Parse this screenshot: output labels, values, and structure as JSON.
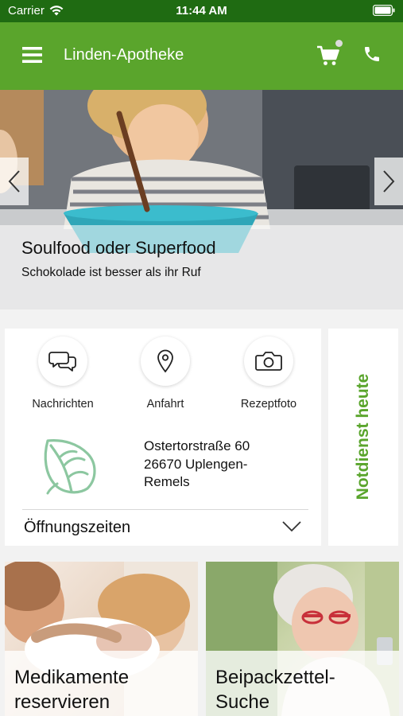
{
  "status_bar": {
    "carrier": "Carrier",
    "time": "11:44 AM"
  },
  "app_bar": {
    "title": "Linden-Apotheke"
  },
  "hero": {
    "title": "Soulfood oder Superfood",
    "subtitle": "Schokolade ist besser als ihr Ruf"
  },
  "actions": {
    "messages": "Nachrichten",
    "directions": "Anfahrt",
    "prescription_photo": "Rezeptfoto"
  },
  "address": {
    "street": "Ostertorstraße  60",
    "city_line1": "26670 Uplengen-",
    "city_line2": "Remels"
  },
  "opening_hours": {
    "label": "Öffnungszeiten"
  },
  "emergency": {
    "label": "Notdienst heute"
  },
  "tiles": [
    {
      "label_line1": "Medikamente",
      "label_line2": "reservieren"
    },
    {
      "label_line1": "Beipackzettel-",
      "label_line2": "Suche"
    }
  ],
  "colors": {
    "brand_green": "#5aa52c",
    "status_bar": "#1f6b12",
    "background": "#f2f2f2"
  }
}
